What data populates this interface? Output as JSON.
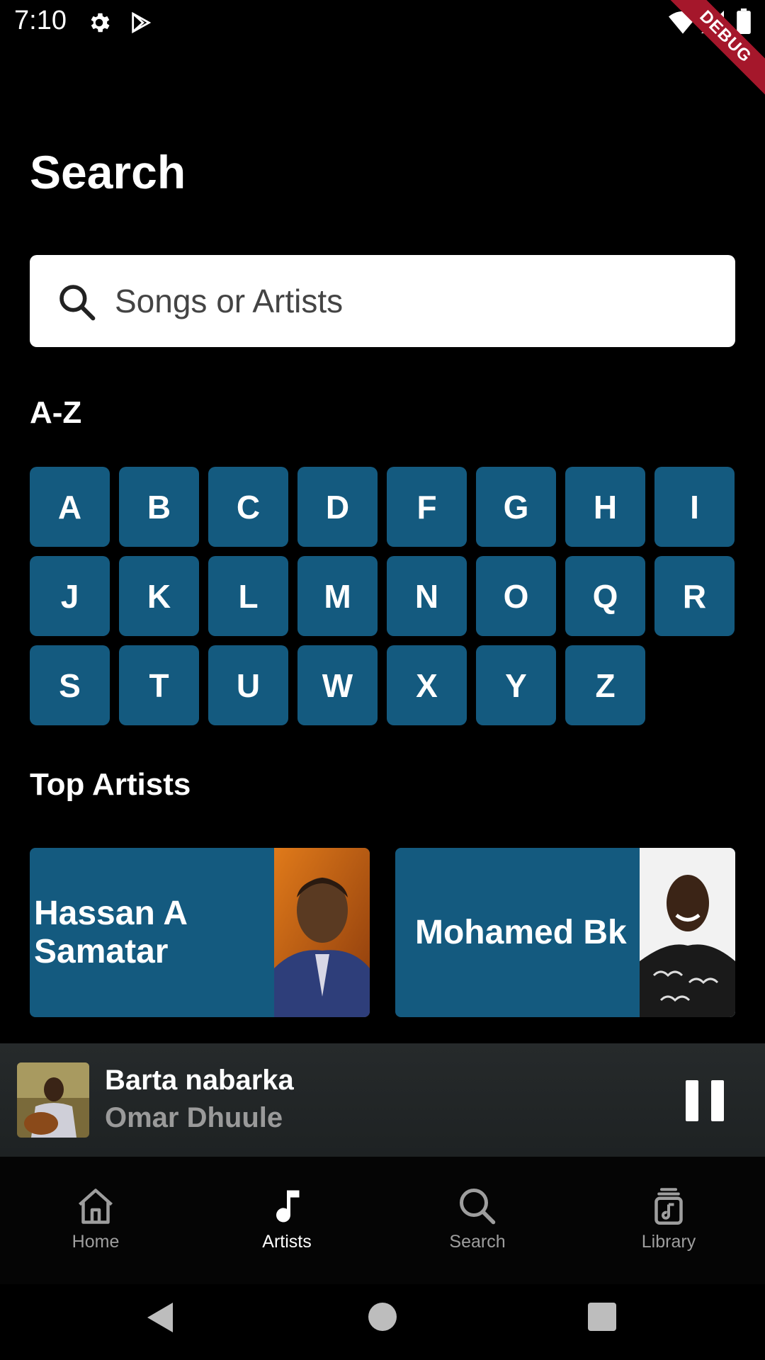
{
  "status_bar": {
    "time": "7:10",
    "debug_label": "DEBUG"
  },
  "page": {
    "title": "Search"
  },
  "search": {
    "placeholder": "Songs or Artists"
  },
  "az": {
    "heading": "A-Z",
    "letters": [
      "A",
      "B",
      "C",
      "D",
      "F",
      "G",
      "H",
      "I",
      "J",
      "K",
      "L",
      "M",
      "N",
      "O",
      "Q",
      "R",
      "S",
      "T",
      "U",
      "W",
      "X",
      "Y",
      "Z"
    ]
  },
  "top_artists": {
    "heading": "Top Artists",
    "items": [
      {
        "name": "Hassan A Samatar"
      },
      {
        "name": "Mohamed Bk"
      }
    ]
  },
  "now_playing": {
    "title": "Barta nabarka",
    "artist": "Omar Dhuule"
  },
  "bottom_nav": {
    "items": [
      {
        "label": "Home",
        "icon": "home-icon"
      },
      {
        "label": "Artists",
        "icon": "music-note-icon",
        "active": true
      },
      {
        "label": "Search",
        "icon": "search-icon"
      },
      {
        "label": "Library",
        "icon": "library-icon"
      }
    ]
  },
  "colors": {
    "accent": "#145a7f",
    "background": "#000000",
    "debug": "#a5172b"
  }
}
